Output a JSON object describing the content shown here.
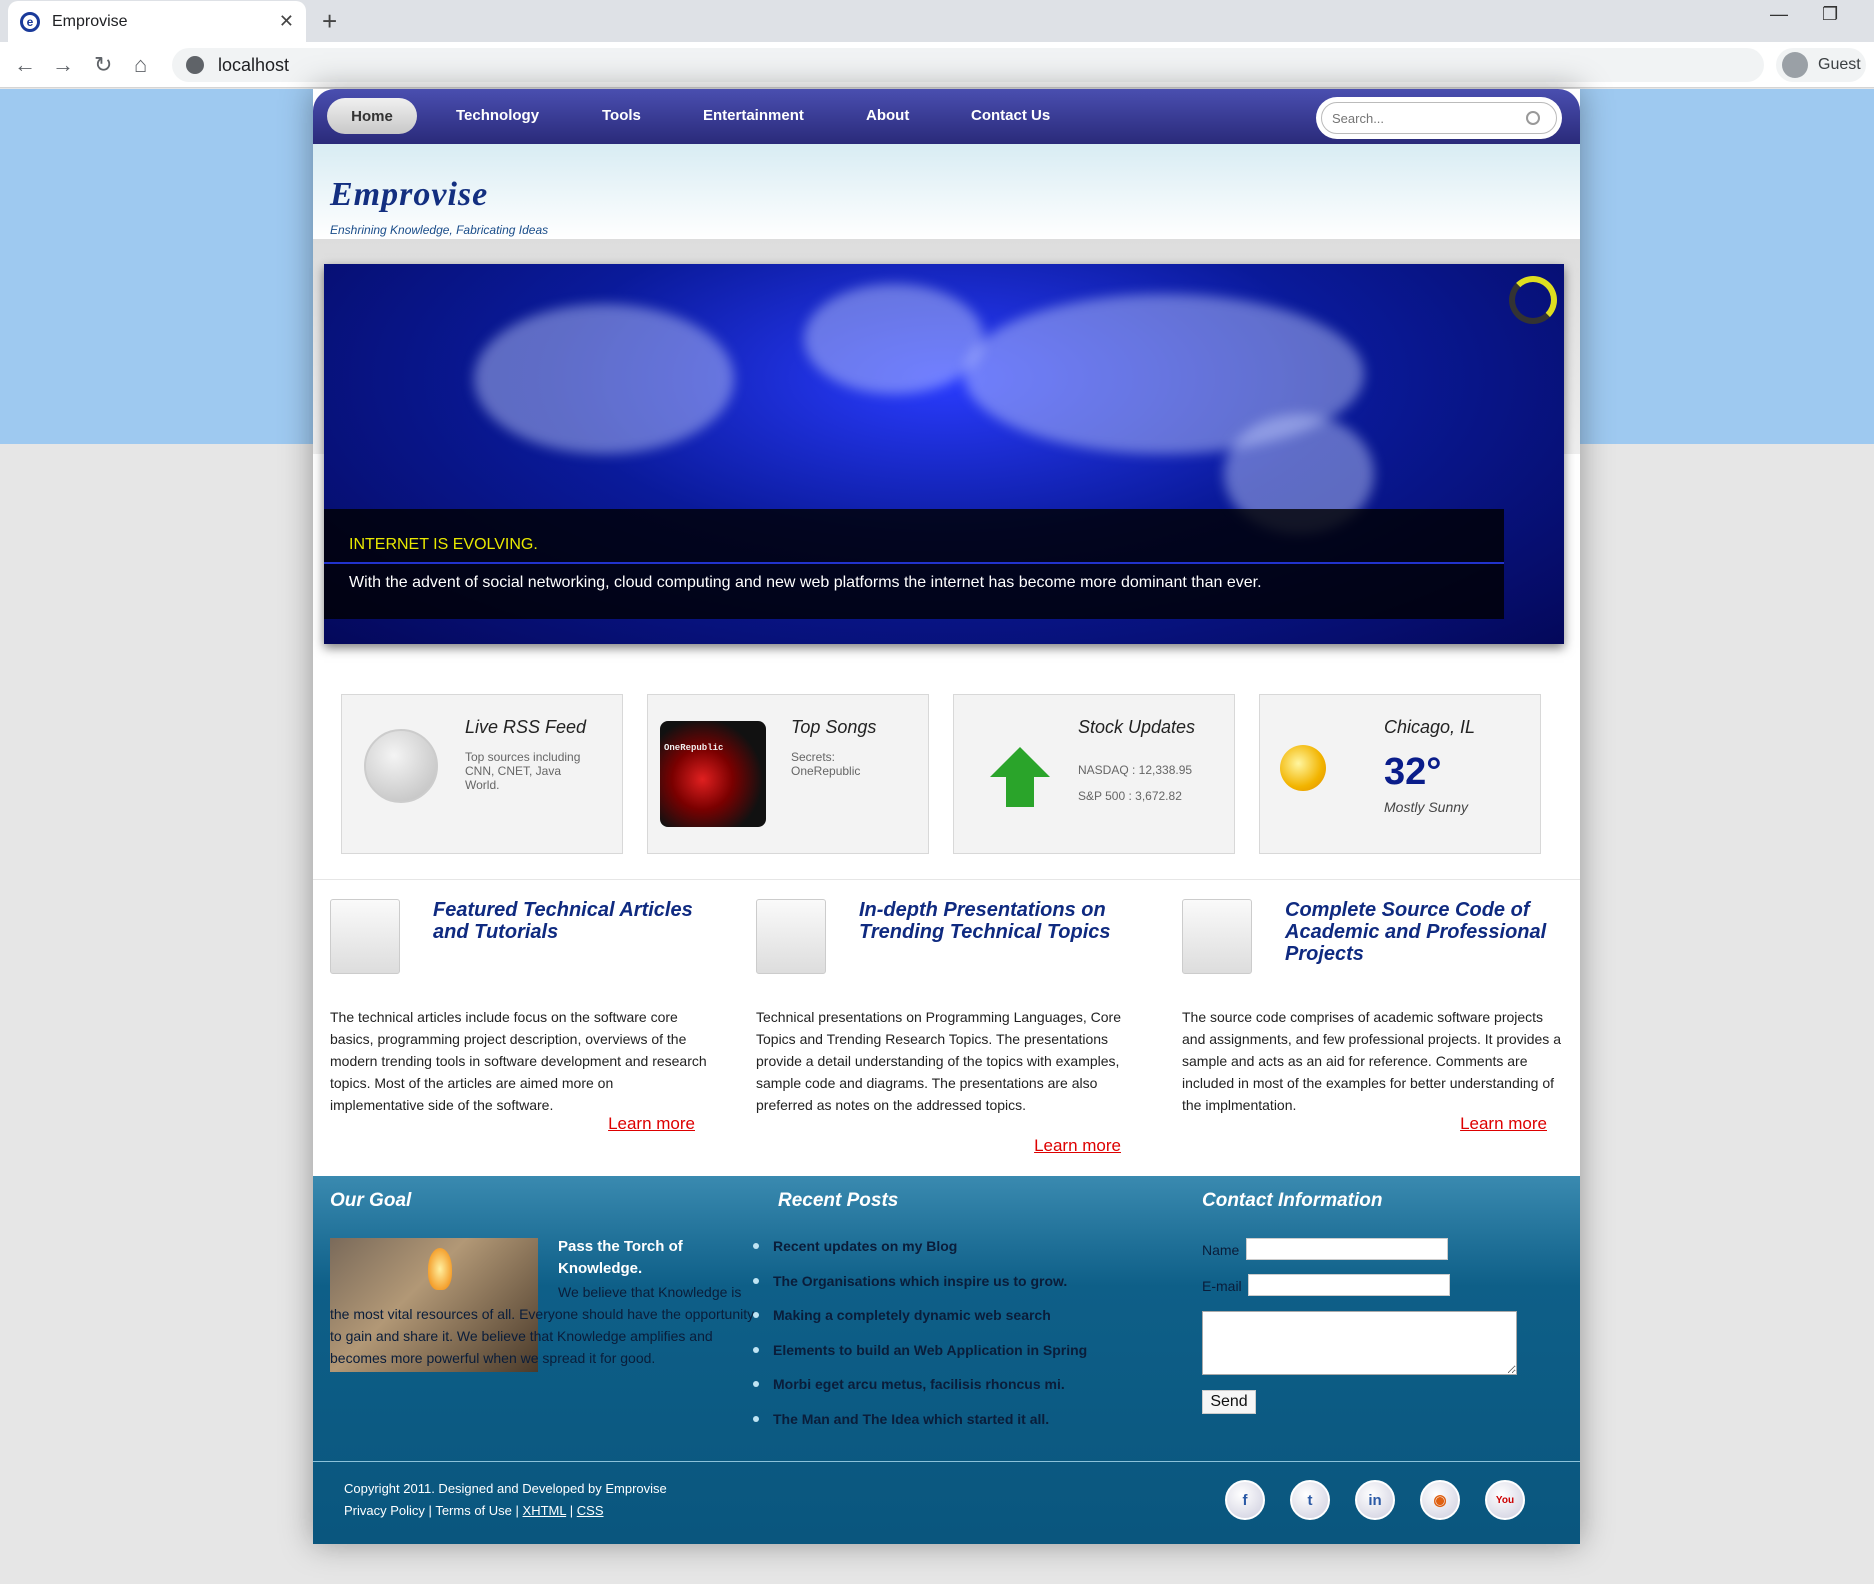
{
  "browser": {
    "tab_title": "Emprovise",
    "tab_close": "✕",
    "new_tab": "+",
    "url": "localhost",
    "profile": "Guest",
    "minimize": "—",
    "restore": "❐"
  },
  "nav": {
    "items": [
      "Home",
      "Technology",
      "Tools",
      "Entertainment",
      "About",
      "Contact Us"
    ],
    "search_placeholder": "Search..."
  },
  "header": {
    "logo": "Emprovise",
    "tagline": "Enshrining Knowledge, Fabricating Ideas"
  },
  "slider": {
    "title": "INTERNET IS EVOLVING.",
    "description": "With the advent of social networking, cloud computing and new web platforms the internet has become more dominant than ever."
  },
  "widgets": {
    "rss": {
      "title": "Live RSS Feed",
      "desc": "Top sources including CNN, CNET, Java World."
    },
    "songs": {
      "title": "Top Songs",
      "album_text": "OneRepublic",
      "desc": "Secrets: OneRepublic"
    },
    "stocks": {
      "title": "Stock Updates",
      "nasdaq": "NASDAQ : 12,338.95",
      "sp500": "S&P 500 : 3,672.82"
    },
    "weather": {
      "city": "Chicago, IL",
      "temp": "32°",
      "condition": "Mostly Sunny"
    }
  },
  "features": [
    {
      "title": "Featured Technical Articles and Tutorials",
      "desc": "The technical articles include focus on the software core basics, programming project description, overviews of the modern trending tools in software development and research topics. Most of the articles are aimed more on implementative side of the software.",
      "link": "Learn more"
    },
    {
      "title": "In-depth Presentations on Trending Technical Topics",
      "desc": "Technical presentations on Programming Languages, Core Topics and Trending Research Topics. The presentations provide a detail understanding of the topics with examples, sample code and diagrams. The presentations are also preferred as notes on the addressed topics.",
      "link": "Learn more"
    },
    {
      "title": "Complete Source Code of Academic and Professional Projects",
      "desc": "The source code comprises of academic software projects and assignments, and few professional projects. It provides a sample and acts as an aid for reference. Comments are included in most of the examples for better understanding of the implmentation.",
      "link": "Learn more"
    }
  ],
  "footer": {
    "goal_title": "Our Goal",
    "goal_head": "Pass the Torch of Knowledge.",
    "goal_text": "We believe that Knowledge is the most vital resources of all. Everyone should have the opportunity to gain and share it. We believe that Knowledge amplifies and becomes more powerful when we spread it for good.",
    "posts_title": "Recent Posts",
    "posts": [
      "Recent updates on my Blog",
      "The Organisations which inspire us to grow.",
      "Making a completely dynamic web search",
      "Elements to build an Web Application in Spring",
      "Morbi eget arcu metus, facilisis rhoncus mi.",
      "The Man and The Idea which started it all."
    ],
    "contact_title": "Contact Information",
    "name_label": "Name",
    "email_label": "E-mail",
    "send": "Send",
    "copyright": "Copyright 2011. Designed and Developed by Emprovise",
    "privacy": "Privacy Policy",
    "terms": "Terms of Use",
    "xhtml": "XHTML",
    "css": "CSS",
    "sep": "|",
    "social": [
      "facebook",
      "twitter",
      "linkedin",
      "rss",
      "youtube"
    ]
  }
}
